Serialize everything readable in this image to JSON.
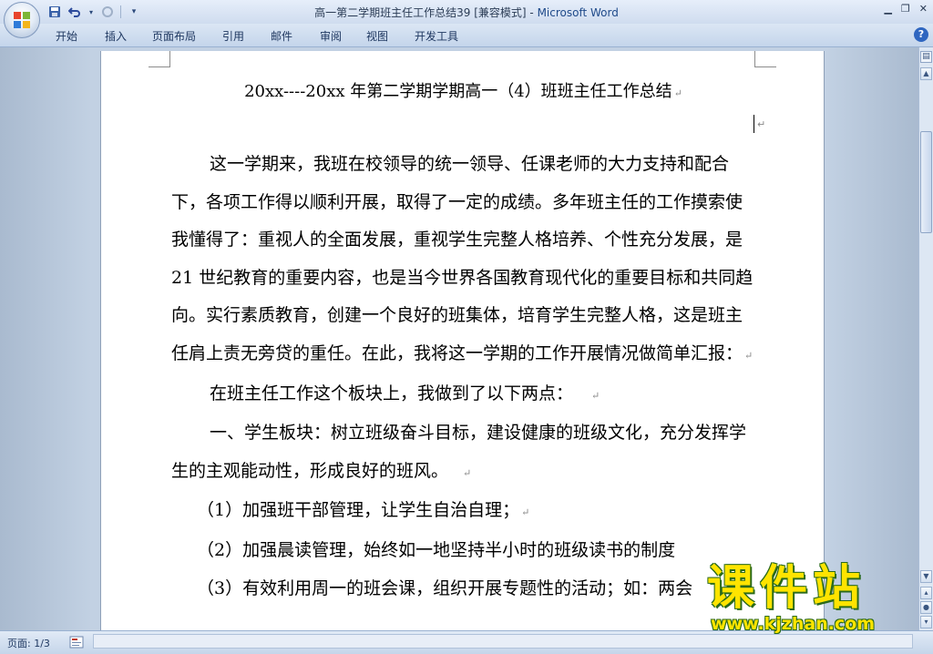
{
  "window": {
    "doc_name": "高一第二学期班主任工作总结39 [兼容模式] - ",
    "app_name": "Microsoft Word"
  },
  "quick_access": [
    "save-icon",
    "undo-icon",
    "redo-icon",
    "customize-icon"
  ],
  "ribbon": {
    "tabs": [
      "开始",
      "插入",
      "页面布局",
      "引用",
      "邮件",
      "审阅",
      "视图",
      "开发工具"
    ]
  },
  "document": {
    "title": "20xx----20xx 年第二学期学期高一（4）班班主任工作总结",
    "paragraphs": [
      "这一学期来，我班在校领导的统一领导、任课老师的大力支持和配合下，各项工作得以顺利开展，取得了一定的成绩。多年班主任的工作摸索使我懂得了：重视人的全面发展，重视学生完整人格培养、个性充分发展，是 21 世纪教育的重要内容，也是当今世界各国教育现代化的重要目标和共同趋向。实行素质教育，创建一个良好的班集体，培育学生完整人格，这是班主任肩上责无旁贷的重任。在此，我将这一学期的工作开展情况做简单汇报：",
      "在班主任工作这个板块上，我做到了以下两点：",
      "一、学生板块：树立班级奋斗目标，建设健康的班级文化，充分发挥学生的主观能动性，形成良好的班风。"
    ],
    "items": [
      "（1）加强班干部管理，让学生自治自理；",
      "（2）加强晨读管理，始终如一地坚持半小时的班级读书的制度",
      "（3）有效利用周一的班会课，组织开展专题性的活动；如：两会"
    ]
  },
  "status": {
    "page": "页面: 1/3"
  },
  "watermark": {
    "brand": "课件站",
    "url": "www.kjzhan.com"
  },
  "colors": {
    "app_name": "#1f4a8a",
    "watermark": "#ffe400"
  }
}
